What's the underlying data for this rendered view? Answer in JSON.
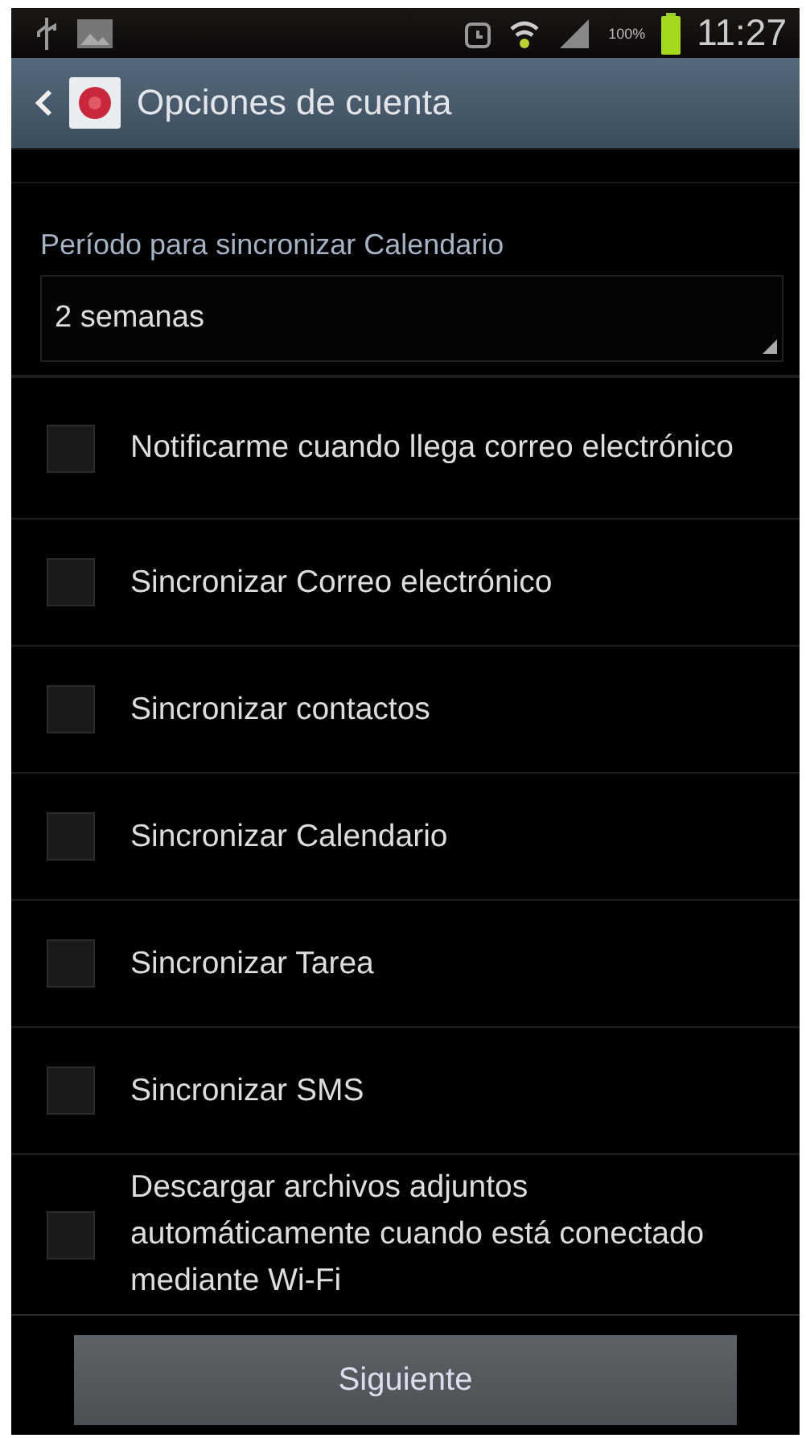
{
  "status_bar": {
    "battery": "100%",
    "time": "11:27"
  },
  "header": {
    "title": "Opciones de cuenta"
  },
  "sync_period": {
    "label": "Período para sincronizar Calendario",
    "value": "2 semanas"
  },
  "options": [
    {
      "label": "Notificarme cuando llega correo electrónico",
      "checked": false
    },
    {
      "label": "Sincronizar Correo electrónico",
      "checked": false
    },
    {
      "label": "Sincronizar contactos",
      "checked": false
    },
    {
      "label": "Sincronizar Calendario",
      "checked": false
    },
    {
      "label": "Sincronizar Tarea",
      "checked": false
    },
    {
      "label": "Sincronizar SMS",
      "checked": false
    },
    {
      "label": "Descargar archivos adjuntos automáticamente cuando está conectado mediante Wi-Fi",
      "checked": false
    }
  ],
  "buttons": [
    "Siguiente"
  ]
}
